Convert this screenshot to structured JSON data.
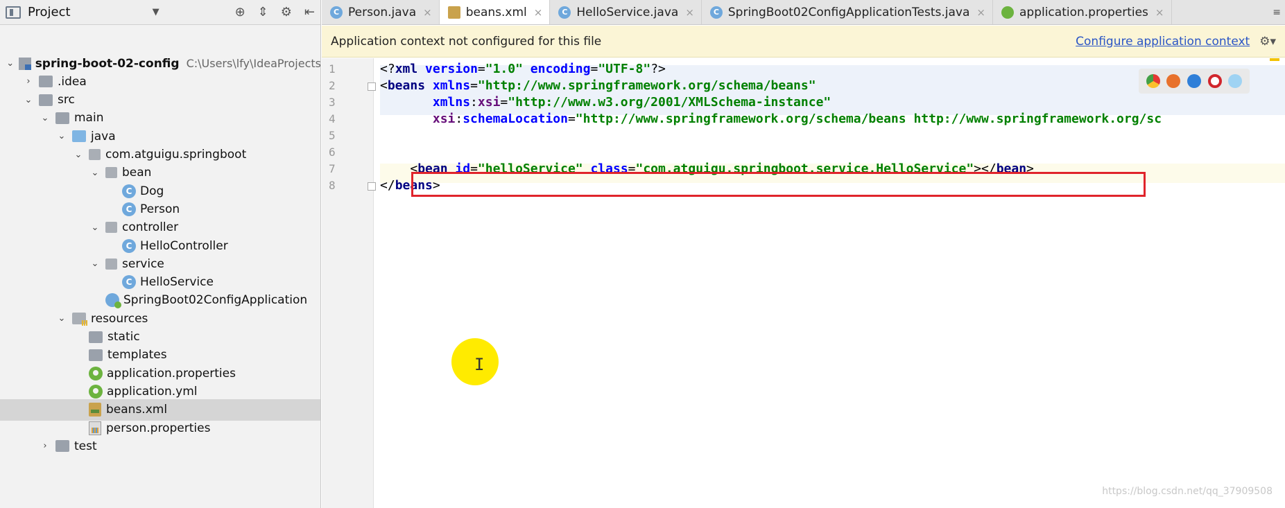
{
  "project_panel": {
    "title": "Project",
    "tree": [
      {
        "label": "spring-boot-02-config",
        "path": "C:\\Users\\lfy\\IdeaProjects",
        "icon": "module-icon",
        "arrow": "down",
        "depth": 0,
        "bold": true
      },
      {
        "label": ".idea",
        "icon": "folder-icon",
        "arrow": "right",
        "depth": 1
      },
      {
        "label": "src",
        "icon": "folder-icon",
        "arrow": "down",
        "depth": 1
      },
      {
        "label": "main",
        "icon": "folder-icon",
        "arrow": "down",
        "depth": 2
      },
      {
        "label": "java",
        "icon": "source-folder-icon",
        "arrow": "down",
        "depth": 3
      },
      {
        "label": "com.atguigu.springboot",
        "icon": "package-icon",
        "arrow": "down",
        "depth": 4
      },
      {
        "label": "bean",
        "icon": "package-icon",
        "arrow": "down",
        "depth": 5
      },
      {
        "label": "Dog",
        "icon": "class-icon",
        "arrow": "none",
        "depth": 6
      },
      {
        "label": "Person",
        "icon": "class-icon",
        "arrow": "none",
        "depth": 6
      },
      {
        "label": "controller",
        "icon": "package-icon",
        "arrow": "down",
        "depth": 5
      },
      {
        "label": "HelloController",
        "icon": "class-icon",
        "arrow": "none",
        "depth": 6
      },
      {
        "label": "service",
        "icon": "package-icon",
        "arrow": "down",
        "depth": 5
      },
      {
        "label": "HelloService",
        "icon": "class-icon",
        "arrow": "none",
        "depth": 6
      },
      {
        "label": "SpringBoot02ConfigApplication",
        "icon": "spring-app-icon",
        "arrow": "none",
        "depth": 5
      },
      {
        "label": "resources",
        "icon": "resources-folder-icon",
        "arrow": "down",
        "depth": 3
      },
      {
        "label": "static",
        "icon": "folder-icon",
        "arrow": "none",
        "depth": 4
      },
      {
        "label": "templates",
        "icon": "folder-icon",
        "arrow": "none",
        "depth": 4
      },
      {
        "label": "application.properties",
        "icon": "spring-config-icon",
        "arrow": "none",
        "depth": 4
      },
      {
        "label": "application.yml",
        "icon": "spring-config-icon",
        "arrow": "none",
        "depth": 4
      },
      {
        "label": "beans.xml",
        "icon": "xml-file-icon",
        "arrow": "none",
        "depth": 4,
        "selected": true
      },
      {
        "label": "person.properties",
        "icon": "properties-file-icon",
        "arrow": "none",
        "depth": 4
      },
      {
        "label": "test",
        "icon": "folder-icon",
        "arrow": "right",
        "depth": 2
      }
    ]
  },
  "tabs": [
    {
      "label": "Person.java",
      "icon": "class-icon",
      "active": false
    },
    {
      "label": "beans.xml",
      "icon": "xml-file-icon",
      "active": true
    },
    {
      "label": "HelloService.java",
      "icon": "class-icon",
      "active": false
    },
    {
      "label": "SpringBoot02ConfigApplicationTests.java",
      "icon": "test-class-icon",
      "active": false
    },
    {
      "label": "application.properties",
      "icon": "spring-config-icon",
      "active": false
    }
  ],
  "notification": {
    "message": "Application context not configured for this file",
    "action": "Configure application context"
  },
  "editor": {
    "lines": [
      {
        "num": "1",
        "tokens": [
          [
            "pun",
            "<?"
          ],
          [
            "tag",
            "xml "
          ],
          [
            "attr",
            "version"
          ],
          [
            "pun",
            "="
          ],
          [
            "str",
            "\"1.0\" "
          ],
          [
            "attr",
            "encoding"
          ],
          [
            "pun",
            "="
          ],
          [
            "str",
            "\"UTF-8\""
          ],
          [
            "pun",
            "?>"
          ]
        ]
      },
      {
        "num": "2",
        "tokens": [
          [
            "pun",
            "<"
          ],
          [
            "tag",
            "beans "
          ],
          [
            "attr",
            "xmlns"
          ],
          [
            "pun",
            "="
          ],
          [
            "str",
            "\"http://www.springframework.org/schema/beans\""
          ]
        ]
      },
      {
        "num": "3",
        "tokens": [
          [
            "pun",
            "       "
          ],
          [
            "attr",
            "xmlns"
          ],
          [
            "pun",
            ":"
          ],
          [
            "ns",
            "xsi"
          ],
          [
            "pun",
            "="
          ],
          [
            "str",
            "\"http://www.w3.org/2001/XMLSchema-instance\""
          ]
        ]
      },
      {
        "num": "4",
        "tokens": [
          [
            "pun",
            "       "
          ],
          [
            "ns",
            "xsi"
          ],
          [
            "pun",
            ":"
          ],
          [
            "attr",
            "schemaLocation"
          ],
          [
            "pun",
            "="
          ],
          [
            "str",
            "\"http://www.springframework.org/schema/beans http://www.springframework.org/sc"
          ]
        ]
      },
      {
        "num": "5",
        "tokens": []
      },
      {
        "num": "6",
        "tokens": []
      },
      {
        "num": "7",
        "tokens": [
          [
            "pun",
            "    <"
          ],
          [
            "tag",
            "bean "
          ],
          [
            "attr",
            "id"
          ],
          [
            "pun",
            "="
          ],
          [
            "str",
            "\"helloService\" "
          ],
          [
            "attr",
            "class"
          ],
          [
            "pun",
            "="
          ],
          [
            "str",
            "\"com.atguigu.springboot.service.HelloService\""
          ],
          [
            "pun",
            "></"
          ],
          [
            "tag",
            "bean"
          ],
          [
            "pun",
            ">"
          ]
        ]
      },
      {
        "num": "8",
        "tokens": [
          [
            "pun",
            "</"
          ],
          [
            "tag",
            "beans"
          ],
          [
            "pun",
            ">"
          ]
        ]
      }
    ]
  },
  "watermark": "https://blog.csdn.net/qq_37909508",
  "colors": {
    "notice_bg": "#fbf5d6",
    "highlight_box": "#e0242b",
    "link": "#2a55c5",
    "selection": "#d5d5d5"
  }
}
